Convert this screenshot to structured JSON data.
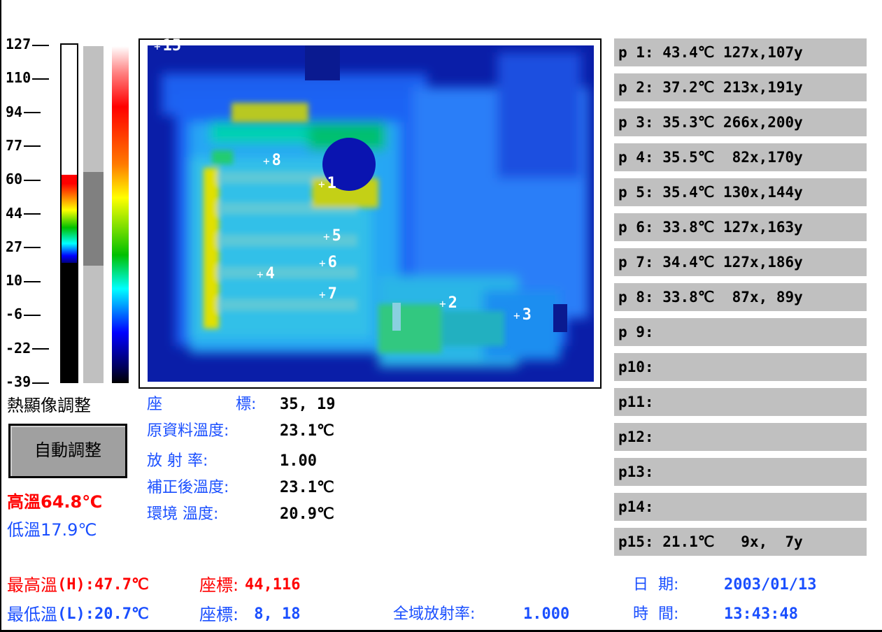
{
  "scale": {
    "ticks": [
      "127",
      "110",
      "94",
      "77",
      "60",
      "44",
      "27",
      "10",
      "-6",
      "-22",
      "-39"
    ],
    "adjust_title": "熱顯像調整",
    "auto_button": "自動調整",
    "high_temp": "高溫64.8℃",
    "low_temp": "低溫17.9℃"
  },
  "image": {
    "markers": [
      "1",
      "2",
      "3",
      "4",
      "5",
      "6",
      "7",
      "8",
      "15"
    ]
  },
  "readout": {
    "coord_label": "座",
    "coord_label2": "標:",
    "coord_value": "35, 19",
    "raw_temp_label": "原資料溫度:",
    "raw_temp_value": "23.1℃",
    "emissivity_label": "放  射  率:",
    "emissivity_value": "1.00",
    "corrected_label": "補正後溫度:",
    "corrected_value": "23.1℃",
    "ambient_label": "環境  溫度:",
    "ambient_value": "20.9℃"
  },
  "points": [
    "p 1: 43.4℃ 127x,107y",
    "p 2: 37.2℃ 213x,191y",
    "p 3: 35.3℃ 266x,200y",
    "p 4: 35.5℃  82x,170y",
    "p 5: 35.4℃ 130x,144y",
    "p 6: 33.8℃ 127x,163y",
    "p 7: 34.4℃ 127x,186y",
    "p 8: 33.8℃  87x, 89y",
    "p 9:",
    "p10:",
    "p11:",
    "p12:",
    "p13:",
    "p14:",
    "p15: 21.1℃   9x,  7y"
  ],
  "footer": {
    "max_label": "最高溫",
    "max_value": "(H):47.7℃",
    "max_coord_label": "座標:",
    "max_coord_value": "44,116",
    "min_label": "最低溫",
    "min_value": "(L):20.7℃",
    "min_coord_label": "座標:",
    "min_coord_value": " 8, 18",
    "global_emis_label": "全域放射率:",
    "global_emis_value": "1.000",
    "date_label": "日  期:",
    "date_value": "2003/01/13",
    "time_label": "時  間:",
    "time_value": "13:43:48"
  },
  "colors": {
    "accent_blue": "#1a4fff",
    "accent_red": "#ff0000",
    "panel_gray": "#c0c0c0"
  }
}
